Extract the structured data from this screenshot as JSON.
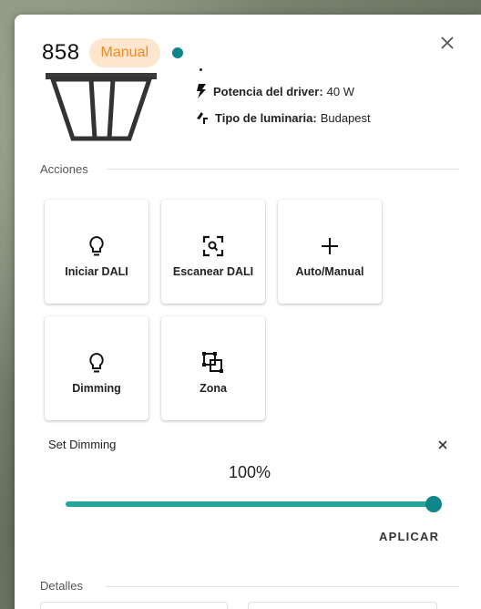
{
  "header": {
    "device_id": "858",
    "mode_badge": "Manual",
    "status_color": "#11868a",
    "badge_color": "#f08a22"
  },
  "specs": [
    {
      "icon": "bolt-icon",
      "label": "Potencia del driver:",
      "value": "40 W"
    },
    {
      "icon": "lamp-type-icon",
      "label": "Tipo de luminaria:",
      "value": "Budapest"
    }
  ],
  "actions": {
    "title": "Acciones",
    "items": [
      {
        "label": "Iniciar DALI",
        "icon": "lightbulb-icon"
      },
      {
        "label": "Escanear DALI",
        "icon": "scan-search-icon"
      },
      {
        "label": "Auto/Manual",
        "icon": "plus-icon"
      },
      {
        "label": "Dimming",
        "icon": "lightbulb-icon"
      },
      {
        "label": "Zona",
        "icon": "zone-icon"
      }
    ]
  },
  "dimming": {
    "title": "Set Dimming",
    "value_text": "100%",
    "level": 1.0,
    "apply_label": "APLICAR",
    "accent": "#26a69a"
  },
  "details": {
    "title": "Detalles"
  }
}
